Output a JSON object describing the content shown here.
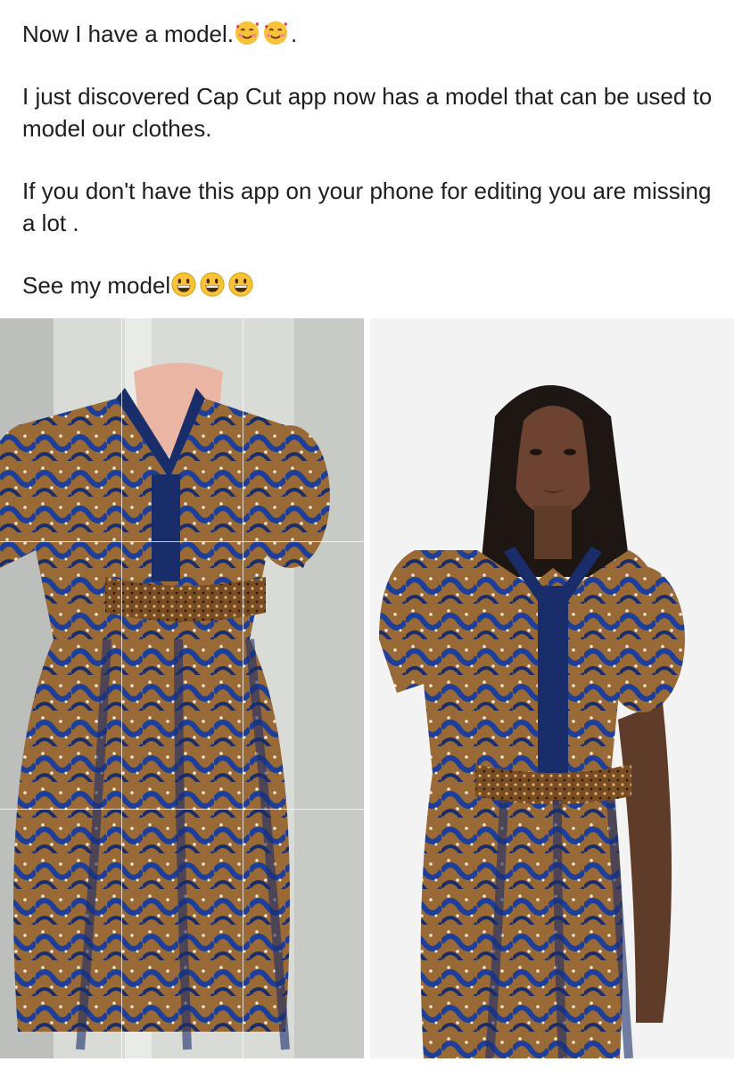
{
  "post": {
    "lines": [
      "Now I have a model.",
      "I just discovered Cap Cut app now has a model that can be used to model our clothes.",
      "If you don't have this app on your phone for editing you are missing a lot .",
      "See my model"
    ],
    "line1_suffix": ".",
    "emojis": {
      "line1": [
        "smiling-face-with-hearts-icon",
        "smiling-face-with-hearts-icon"
      ],
      "line4": [
        "grinning-face-icon",
        "grinning-face-icon",
        "grinning-face-icon"
      ]
    }
  },
  "photos": [
    {
      "subject": "dress-on-mannequin",
      "grid_overlay": true
    },
    {
      "subject": "dress-on-model",
      "grid_overlay": false
    }
  ],
  "colors": {
    "text": "#1c1e21",
    "dress_blue": "#1d3f9a",
    "dress_navy": "#1a2d6b",
    "dress_brown": "#9a6a36",
    "skin": "#6b4330",
    "hair": "#1d1612"
  }
}
